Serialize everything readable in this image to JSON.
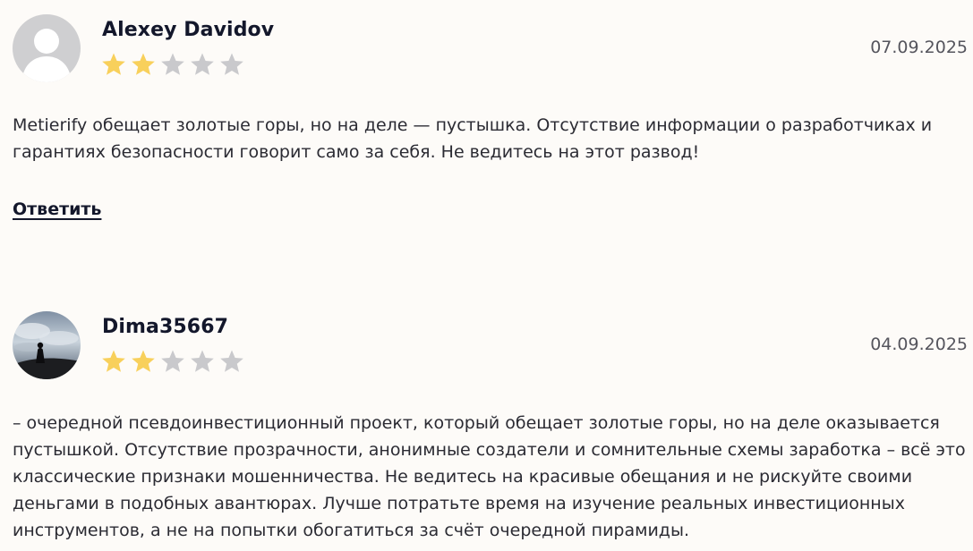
{
  "colors": {
    "star_filled": "#f8d05b",
    "star_empty": "#c9c9cc",
    "author": "#13172b",
    "text": "#2b2b33",
    "background": "#fdfbf8"
  },
  "reviews": [
    {
      "author": "Alexey Davidov",
      "avatar": "default-user-avatar",
      "rating": 2,
      "max_rating": 5,
      "date": "07.09.2025",
      "text": "Metierify обещает золотые горы, но на деле — пустышка. Отсутствие информации о разработчиках и гарантиях безопасности говорит само за себя. Не ведитесь на этот развод!",
      "reply_label": "Ответить"
    },
    {
      "author": "Dima35667",
      "avatar": "photo-avatar-silhouette-sky",
      "rating": 2,
      "max_rating": 5,
      "date": "04.09.2025",
      "text": "– очередной псевдоинвестиционный проект, который обещает золотые горы, но на деле оказывается пустышкой. Отсутствие прозрачности, анонимные создатели и сомнительные схемы заработка – всё это классические признаки мошенничества. Не ведитесь на красивые обещания и не рискуйте своими деньгами в подобных авантюрах. Лучше потратьте время на изучение реальных инвестиционных инструментов, а не на попытки обогатиться за счёт очередной пирамиды."
    }
  ]
}
